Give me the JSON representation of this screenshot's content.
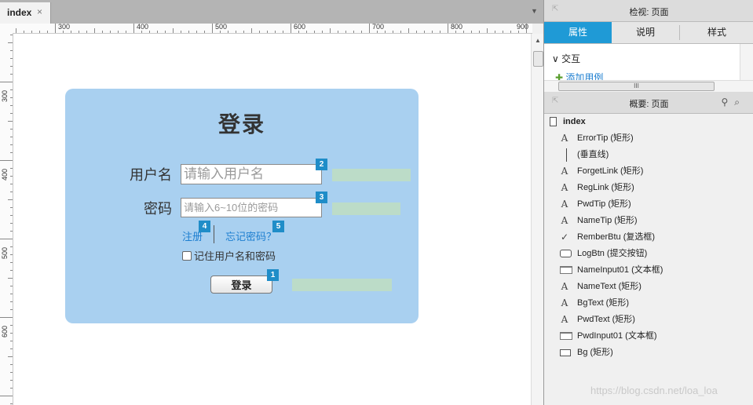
{
  "tab": {
    "label": "index",
    "close": "×",
    "dropdown": "▼"
  },
  "ruler": {
    "h_labels": [
      "300",
      "400",
      "500",
      "600",
      "700",
      "800",
      "900"
    ],
    "v_labels": [
      "300",
      "400",
      "500",
      "600"
    ]
  },
  "canvas": {
    "title": "登录",
    "username_label": "用户名",
    "username_placeholder": "请输入用户名",
    "password_label": "密码",
    "password_placeholder": "请输入6~10位的密码",
    "register_link": "注册",
    "forget_link": "忘记密码？",
    "remember_label": "记住用户名和密码",
    "login_button": "登录",
    "badges": [
      "2",
      "3",
      "4",
      "5",
      "1"
    ]
  },
  "inspector": {
    "title": "检视: 页面",
    "tabs": [
      "属性",
      "说明",
      "样式"
    ],
    "active_tab": "属性",
    "section": "交互",
    "add_case": "添加用例",
    "scroll_grip": "III"
  },
  "outline": {
    "title": "概要: 页面",
    "root": "index",
    "items": [
      {
        "icon": "text-icon",
        "label": "ErrorTip (矩形)"
      },
      {
        "icon": "vline-icon",
        "label": "(垂直线)"
      },
      {
        "icon": "text-icon",
        "label": "ForgetLink (矩形)"
      },
      {
        "icon": "text-icon",
        "label": "RegLink (矩形)"
      },
      {
        "icon": "text-icon",
        "label": "PwdTip (矩形)"
      },
      {
        "icon": "text-icon",
        "label": "NameTip (矩形)"
      },
      {
        "icon": "check-icon",
        "label": "RemberBtu (复选框)"
      },
      {
        "icon": "button-icon",
        "label": "LogBtn (提交按钮)"
      },
      {
        "icon": "input-icon",
        "label": "NameInput01 (文本框)"
      },
      {
        "icon": "text-icon",
        "label": "NameText (矩形)"
      },
      {
        "icon": "text-icon",
        "label": "BgText (矩形)"
      },
      {
        "icon": "text-icon",
        "label": "PwdText (矩形)"
      },
      {
        "icon": "input-icon",
        "label": "PwdInput01 (文本框)"
      },
      {
        "icon": "rect-icon",
        "label": "Bg (矩形)"
      }
    ]
  },
  "watermark": "https://blog.csdn.net/loa_loa",
  "colors": {
    "accent": "#1f9ad6",
    "card": "#a9d0f0",
    "tip": "#bcdcc8",
    "link": "#1e7fd0"
  }
}
